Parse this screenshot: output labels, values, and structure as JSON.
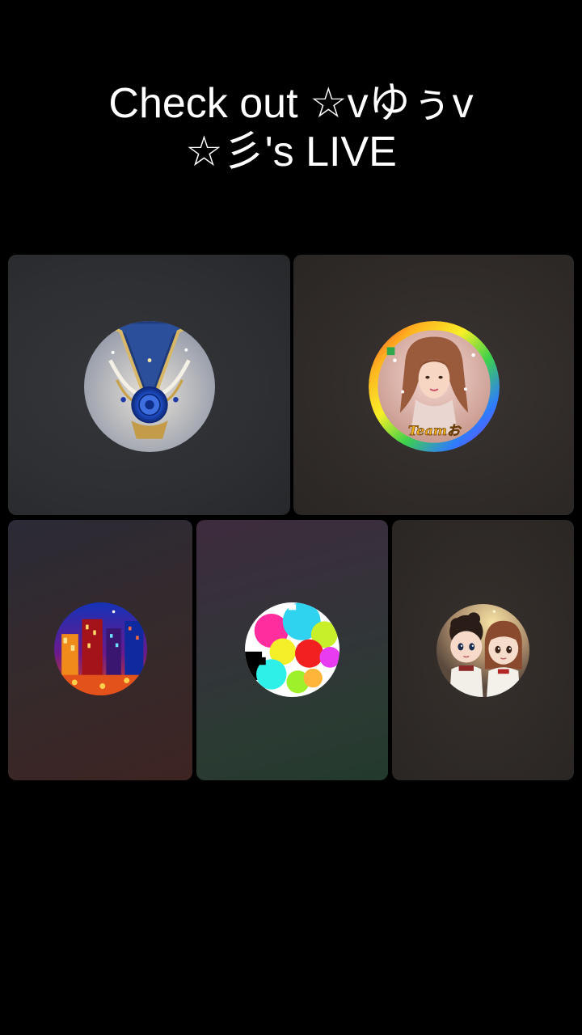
{
  "headline": {
    "line1": "Check out ☆vゆぅv",
    "line2": "☆彡's LIVE"
  },
  "tiles": [
    {
      "avatar": "blue-rose-v-emblem-avatar"
    },
    {
      "avatar": "woman-portrait-rainbow-frame-avatar",
      "badge_text": "Teamお"
    },
    {
      "avatar": "neon-city-night-avatar"
    },
    {
      "avatar": "colorful-pixel-blobs-avatar"
    },
    {
      "avatar": "two-dolls-avatar"
    }
  ],
  "colors": {
    "background": "#000000",
    "tile": "#2e3034",
    "text": "#ffffff"
  }
}
